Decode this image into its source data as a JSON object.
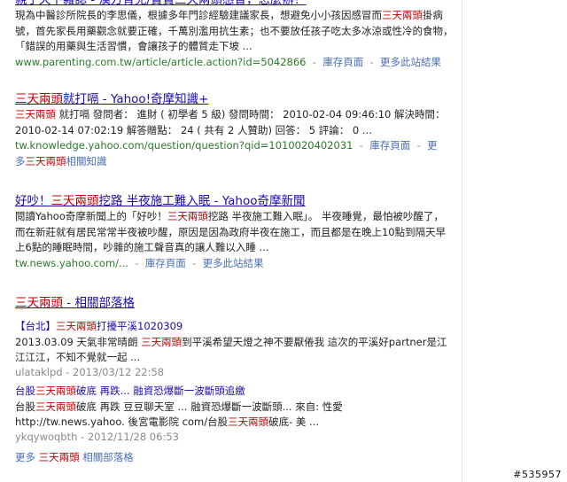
{
  "results": [
    {
      "title": "親子天下雜誌 - 漢方育兒/寶寶三天兩頭感冒，怎麼辦？",
      "snippet_parts": [
        {
          "t": "現為中醫診所院長的李思儀，根據多年門診經驗建議家長，想避免小小孩因感冒而"
        },
        {
          "t": "三天兩頭",
          "hl": true
        },
        {
          "t": "掛病號，首先家長用藥觀念就要正確，千萬別濫用抗生素；也不要放任孩子吃太多冰涼或性冷的食物，「錯誤的用藥與生活習慣，會讓孩子的體質走下坡 ..."
        }
      ],
      "url": "www.parenting.com.tw/article/article.action?id=5042866",
      "cache": "庫存頁面",
      "more": "更多此站結果"
    },
    {
      "title_parts": [
        {
          "t": "三天兩頭",
          "hl": true
        },
        {
          "t": "就打嗝 - Yahoo!奇摩知識+"
        }
      ],
      "snippet_parts": [
        {
          "t": "三天兩頭",
          "hl": true
        },
        {
          "t": " 就打嗝 發問者： 進財 ( 初學者 5 級) 發問時間： 2010-02-04 09:46:10 解決時間： 2010-02-14 07:02:19 解答贈點： 24 ( 共有 2 人贊助) 回答： 5 評論： 0 ..."
        }
      ],
      "url": "tw.knowledge.yahoo.com/question/question?qid=1010020402031",
      "cache": "庫存頁面",
      "more_a": "更",
      "more_b": "多",
      "more_kw": "三天兩頭",
      "more_tail": "相關知識"
    },
    {
      "title_parts": [
        {
          "t": "好吵！"
        },
        {
          "t": "三天兩頭",
          "hl": true
        },
        {
          "t": "挖路 半夜施工難入眠 - Yahoo奇摩新聞"
        }
      ],
      "snippet_parts": [
        {
          "t": "閱讀Yahoo奇摩新聞上的「好吵！"
        },
        {
          "t": "三天兩頭",
          "hl": true
        },
        {
          "t": "挖路 半夜施工難入眠」。 半夜睡覺，最怕被吵醒了，而在新莊就有居民常常半夜被吵醒，原因是因為政府半夜在施工，而且都是在晚上10點到隔天早上6點的睡眠時間，吵雜的施工聲音真的讓人難以入睡 ..."
        }
      ],
      "url": "tw.news.yahoo.com/...",
      "cache": "庫存頁面",
      "more": "更多此站結果"
    },
    {
      "title_parts": [
        {
          "t": "三天兩頭",
          "hl": true
        },
        {
          "t": " - 相關部落格"
        }
      ],
      "subs": [
        {
          "title_parts": [
            {
              "t": "【台北】"
            },
            {
              "t": "三天兩頭",
              "hl": true
            },
            {
              "t": "打擾平溪1020309"
            }
          ],
          "snippet_parts": [
            {
              "t": "2013.03.09 天氣非常晴朗 "
            },
            {
              "t": "三天兩頭",
              "hl": true
            },
            {
              "t": "到平溪希望天燈之神不要厭倦我 這次的平溪好partner是江江江江，不知不覺就一起 ..."
            }
          ],
          "meta": "ulataklpd - 2013/03/12 22:58"
        },
        {
          "title_parts": [
            {
              "t": "台股"
            },
            {
              "t": "三天兩頭",
              "hl": true
            },
            {
              "t": "破底 再跌... 融資恐爆斷一波斷頭追繳"
            }
          ],
          "snippet_parts": [
            {
              "t": "台股"
            },
            {
              "t": "三天兩頭",
              "hl": true
            },
            {
              "t": "破底 再跌 豆豆聊天室 ... 融資恐爆斷一波斷頭... 來自: 性愛 http://tw.news.yahoo. 後宮電影院 com/台股"
            },
            {
              "t": "三天兩頭",
              "hl": true
            },
            {
              "t": "破底- 美 ..."
            }
          ],
          "meta": "ykqywoqbth - 2012/11/28 06:53"
        }
      ],
      "more_prefix": "更多",
      "more_kw": "三天兩頭",
      "more_suffix": " 相關部落格"
    }
  ],
  "watermark": "#535957"
}
